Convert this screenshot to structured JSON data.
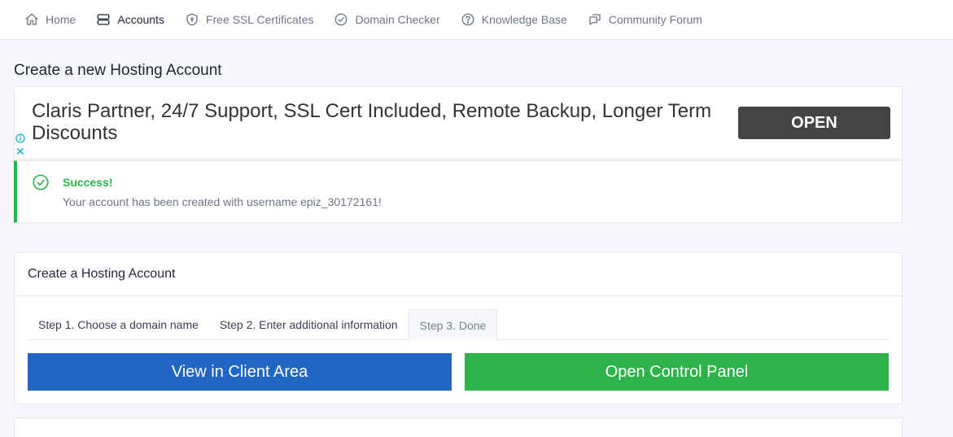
{
  "nav": {
    "items": [
      {
        "label": "Home",
        "icon": "home-icon"
      },
      {
        "label": "Accounts",
        "icon": "server-icon"
      },
      {
        "label": "Free SSL Certificates",
        "icon": "shield-icon"
      },
      {
        "label": "Domain Checker",
        "icon": "check-circle-icon"
      },
      {
        "label": "Knowledge Base",
        "icon": "help-circle-icon"
      },
      {
        "label": "Community Forum",
        "icon": "forum-icon"
      }
    ],
    "active": "Accounts"
  },
  "page": {
    "title": "Create a new Hosting Account"
  },
  "ad": {
    "text": "Claris Partner, 24/7 Support, SSL Cert Included, Remote Backup, Longer Term Discounts",
    "button": "OPEN",
    "close": "✕"
  },
  "alert": {
    "title": "Success!",
    "message": "Your account has been created with username epiz_30172161!"
  },
  "hosting": {
    "header": "Create a Hosting Account",
    "tabs": [
      {
        "label": "Step 1. Choose a domain name"
      },
      {
        "label": "Step 2. Enter additional information"
      },
      {
        "label": "Step 3. Done"
      }
    ],
    "active_tab": "Step 3. Done",
    "client_area_button": "View in Client Area",
    "control_panel_button": "Open Control Panel"
  },
  "colors": {
    "success": "#2db54b",
    "primary_blue": "#2266c4",
    "primary_green": "#2db34a",
    "ad_button": "#444444"
  }
}
